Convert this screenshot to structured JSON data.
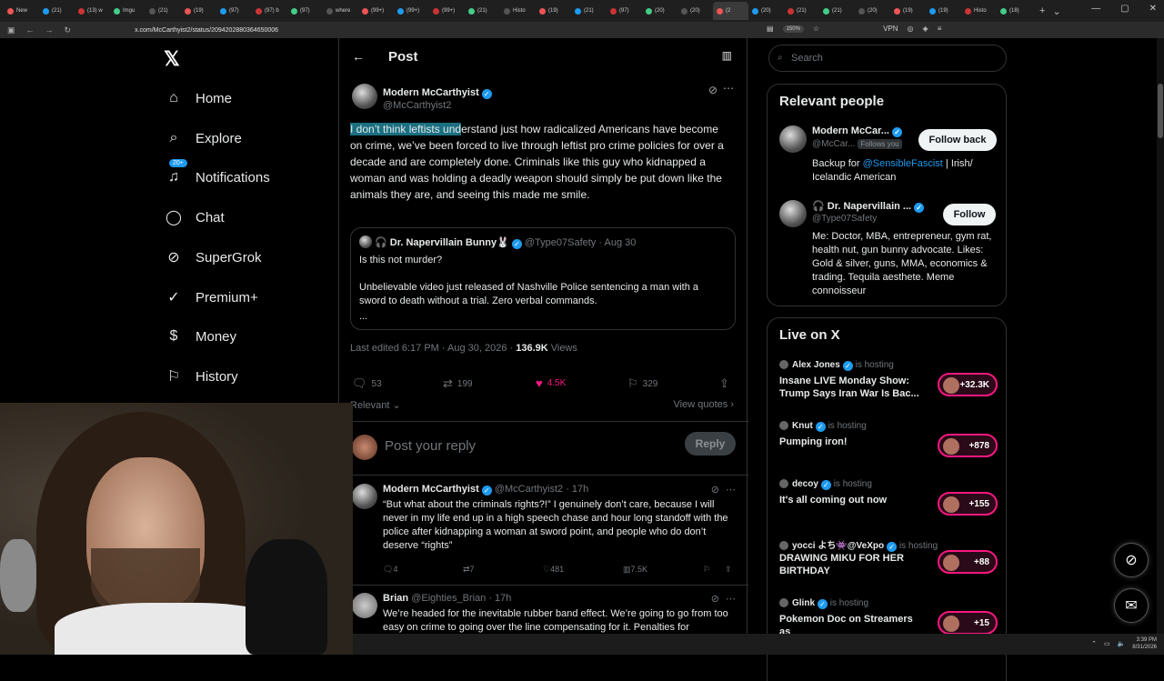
{
  "browser": {
    "tabs": [
      "New",
      "(21) ",
      "(13) w",
      "Imgu",
      "(21) ",
      "(19) ",
      "(97) ",
      "(97) b",
      "(97) ",
      "where",
      "(99+)",
      "(99+)",
      "(99+)",
      "(21) ",
      "Histo",
      "(19) ",
      "(21) ",
      "(97) ",
      "(20) ",
      "(20) ",
      "(2",
      "(20) ",
      "(21) ",
      "(21) ",
      "(20) ",
      "(19) ",
      "(19) ",
      "Histo",
      "(18) "
    ],
    "url": "x.com/McCarthyist2/status/2094202880364650006",
    "zoom": "150%",
    "vpn": "VPN"
  },
  "nav": {
    "items": [
      {
        "label": "Home",
        "icon": "home-icon"
      },
      {
        "label": "Explore",
        "icon": "search-icon"
      },
      {
        "label": "Notifications",
        "icon": "bell-icon",
        "badge": "20+"
      },
      {
        "label": "Chat",
        "icon": "chat-icon"
      },
      {
        "label": "SuperGrok",
        "icon": "grok-icon"
      },
      {
        "label": "Premium+",
        "icon": "premium-icon"
      },
      {
        "label": "Money",
        "icon": "money-icon"
      },
      {
        "label": "History",
        "icon": "bookmark-icon"
      }
    ]
  },
  "post": {
    "header_title": "Post",
    "author_name": "Modern McCarthyist",
    "author_handle": "@McCarthyist2",
    "text_highlight": "I don’t think leftists und",
    "text_rest": "erstand just how radicalized Americans have become on crime, we’ve been forced to live through leftist pro crime policies for over a decade and are completely done. Criminals like this guy who kidnapped a woman and was holding a deadly weapon should simply be put down like the animals they are, and seeing this made me smile.",
    "quote": {
      "name": "🎧 Dr. Napervillain Bunny🐰",
      "handle": "@Type07Safety",
      "date": "· Aug 30",
      "line1": "Is this not murder?",
      "line2": "Unbelievable video just released of Nashville Police sentencing a man with a sword to death without a trial. Zero verbal commands.",
      "ellipsis": "..."
    },
    "edited": "Last edited 6:17 PM · Aug 30, 2026 · ",
    "views_count": "136.9K",
    "views_label": " Views",
    "replies": "53",
    "reposts": "199",
    "likes": "4.5K",
    "bookmarks": "329",
    "relevant": "Relevant",
    "view_quotes": "View quotes",
    "reply_placeholder": "Post your reply",
    "reply_button": "Reply",
    "like_color": "#f91880"
  },
  "replies": [
    {
      "name": "Modern McCarthyist",
      "handle": "@McCarthyist2 · 17h",
      "text": "“But what about the criminals rights?!” I genuinely don’t care, because I will never in my life end up in a high speech chase and hour long standoff with the police after kidnapping a woman at sword point, and people who do don’t deserve “rights”",
      "replies": "4",
      "reposts": "7",
      "likes": "481",
      "views": "7.5K"
    },
    {
      "name": "Brian",
      "handle": "@Eighties_Brian · 17h",
      "text": "We’re headed for the inevitable rubber band effect. We’re going to go from too easy on crime to going over the line compensating for it. Penalties for"
    }
  ],
  "right": {
    "search_placeholder": "Search",
    "relevant_title": "Relevant people",
    "people": [
      {
        "name": "Modern McCar...",
        "handle": "@McCar...",
        "follows_you": "Follows you",
        "button": "Follow back",
        "bio_pre": "Backup for ",
        "bio_link": "@SensibleFascist",
        "bio_post": " | Irish/ Icelandic American"
      },
      {
        "name": "🎧 Dr. Napervillain ...",
        "handle": "@Type07Safety",
        "button": "Follow",
        "bio": "Me: Doctor, MBA, entrepreneur, gym rat, health nut, gun bunny advocate. Likes: Gold & silver, guns, MMA, economics & trading. Tequila aesthete. Meme connoisseur"
      }
    ],
    "live_title": "Live on X",
    "live": [
      {
        "host": "Alex Jones",
        "status": "is hosting",
        "title": "Insane LIVE Monday Show: Trump Says Iran War Is Bac...",
        "count": "+32.3K"
      },
      {
        "host": "Knut",
        "status": "is hosting",
        "title": "Pumping iron!",
        "count": "+878"
      },
      {
        "host": "decoy",
        "status": "is hosting",
        "title": "It's all coming out now",
        "count": "+155"
      },
      {
        "host": "yocci よち👾@VeXpo",
        "status": "is hosting",
        "title": "DRAWING MIKU FOR HER BIRTHDAY",
        "count": "+88"
      },
      {
        "host": "Glink",
        "status": "is hosting",
        "title": "Pokemon Doc on Streamers as",
        "count": "+15"
      }
    ]
  },
  "taskbar": {
    "time": "3:39 PM",
    "date": "8/31/2026"
  }
}
